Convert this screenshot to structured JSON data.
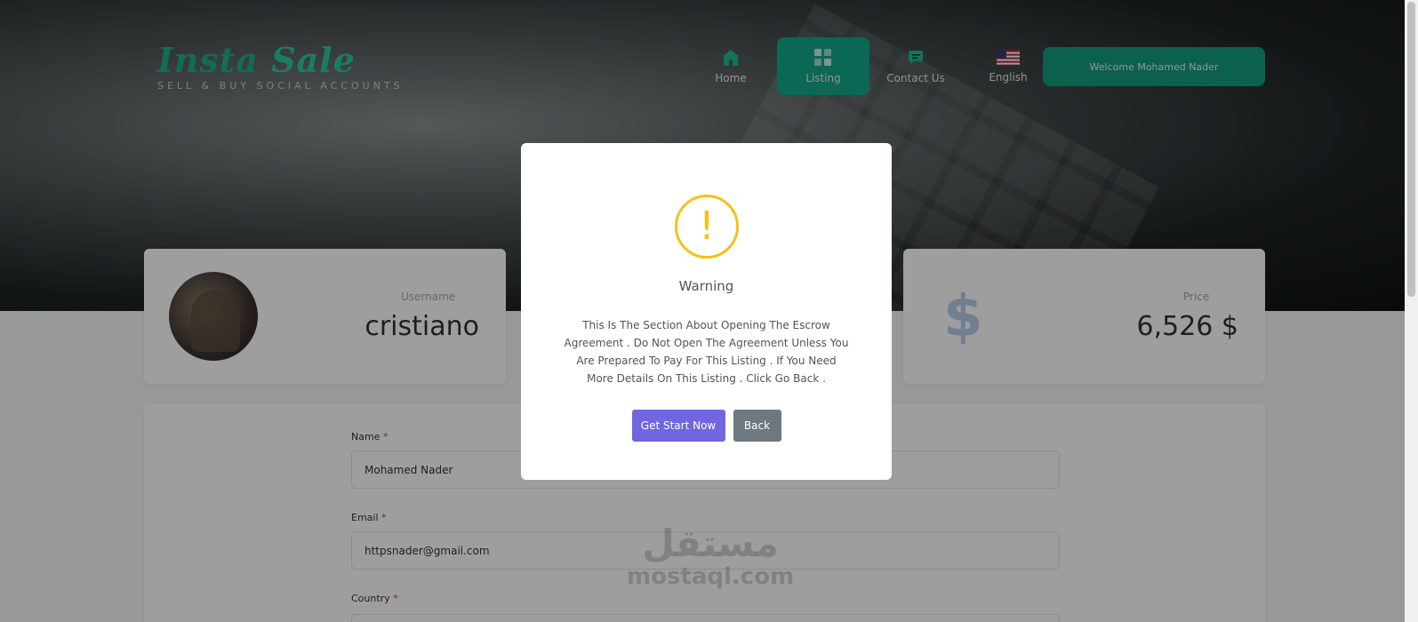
{
  "header": {
    "brand_part1": "Insta",
    "brand_part2": "Sale",
    "tagline": "SELL & BUY SOCIAL ACCOUNTS",
    "nav": [
      {
        "label": "Home",
        "icon": "home-icon"
      },
      {
        "label": "Listing",
        "icon": "grid-icon",
        "active": true
      },
      {
        "label": "Contact Us",
        "icon": "chat-icon"
      },
      {
        "label": "English",
        "icon": "us-flag-icon"
      }
    ],
    "welcome": "Welcome Mohamed Nader"
  },
  "summary": {
    "username_label": "Username",
    "username_value": "cristiano",
    "price_label": "Price",
    "price_value": "6,526 $",
    "price_icon": "dollar-icon"
  },
  "form": {
    "name_label": "Name",
    "name_value": "Mohamed Nader",
    "email_label": "Email",
    "email_value": "httpsnader@gmail.com",
    "country_label": "Country",
    "required_mark": "*"
  },
  "watermark": {
    "arabic": "مستقل",
    "latin": "mostaql.com"
  },
  "modal": {
    "icon_glyph": "!",
    "title": "Warning",
    "lines": [
      "This Is The Section About Opening The Escrow",
      "Agreement . Do Not Open The Agreement Unless You",
      "Are Prepared To Pay For This Listing . If You Need",
      "More Details On This Listing . Click Go Back ."
    ],
    "confirm_label": "Get Start Now",
    "cancel_label": "Back"
  },
  "colors": {
    "accent": "#13a88a",
    "warning": "#f4c118",
    "confirm": "#7066e0",
    "cancel": "#6e7881"
  }
}
